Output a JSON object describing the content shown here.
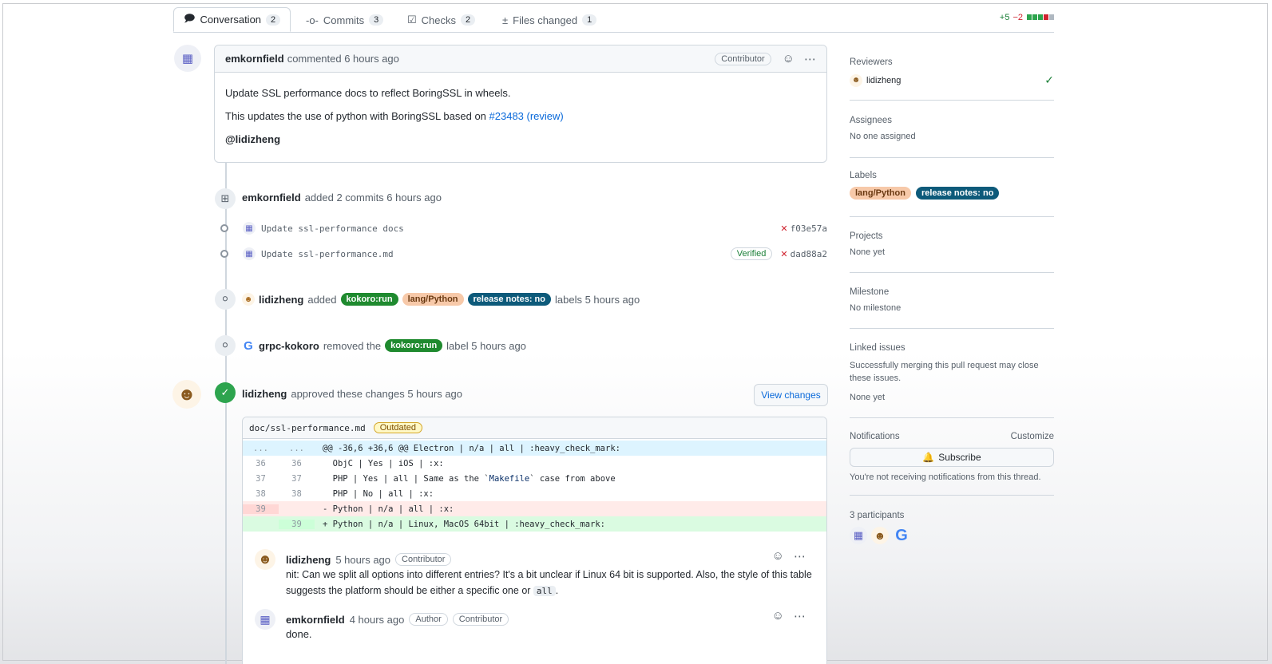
{
  "tabs": {
    "conversation": {
      "label": "Conversation",
      "count": "2"
    },
    "commits": {
      "label": "Commits",
      "count": "3"
    },
    "checks": {
      "label": "Checks",
      "count": "2"
    },
    "files": {
      "label": "Files changed",
      "count": "1"
    }
  },
  "diffstat": {
    "additions": "+5",
    "deletions": "−2"
  },
  "comment": {
    "author": "emkornfield",
    "action": "commented 6 hours ago",
    "badge": "Contributor",
    "line1": "Update SSL performance docs to reflect BoringSSL in wheels.",
    "line2_prefix": "This updates the use of python with BoringSSL based on",
    "line2_link": "#23483 (review)",
    "mention": "@lidizheng"
  },
  "commits_event": {
    "author": "emkornfield",
    "text": "added 2 commits 6 hours ago"
  },
  "commits": [
    {
      "message": "Update ssl-performance docs",
      "sha": "f03e57a",
      "verified": ""
    },
    {
      "message": "Update ssl-performance.md",
      "sha": "dad88a2",
      "verified": "Verified"
    }
  ],
  "labels_event": {
    "author": "lidizheng",
    "verb": "added",
    "suffix": "labels 5 hours ago"
  },
  "label_names": {
    "kokoro": "kokoro:run",
    "python": "lang/Python",
    "release": "release notes: no"
  },
  "removed_event": {
    "author": "grpc-kokoro",
    "verb": "removed the",
    "suffix": "label 5 hours ago"
  },
  "review_event": {
    "author": "lidizheng",
    "text": "approved these changes 5 hours ago",
    "button": "View changes"
  },
  "diff": {
    "file": "doc/ssl-performance.md",
    "outdated": "Outdated",
    "hunk_left": "...",
    "hunk_right": "...",
    "hunk": "@@ -36,6 +36,6 @@ Electron | n/a | all | :heavy_check_mark:",
    "lines": [
      {
        "old": "36",
        "new": "36",
        "text": "  ObjC | Yes | iOS | :x:"
      },
      {
        "old": "37",
        "new": "37",
        "text_a": "  PHP | Yes | all | Same as the `",
        "text_b": "Makefile",
        "text_c": "` case from above"
      },
      {
        "old": "38",
        "new": "38",
        "text": "  PHP | No | all | :x:"
      },
      {
        "old": "39",
        "new": "",
        "text": "- Python | n/a | all | :x:"
      },
      {
        "old": "",
        "new": "39",
        "text": "+ Python | n/a | Linux, MacOS 64bit | :heavy_check_mark:"
      }
    ]
  },
  "review_comments": [
    {
      "author": "lidizheng",
      "time": "5 hours ago",
      "badges": [
        "Contributor"
      ],
      "body_prefix": "nit: Can we split all options into different entries? It's a bit unclear if Linux 64 bit is supported. Also, the style of this table suggests the platform should be either a specific one or",
      "code": "all",
      "body_suffix": "."
    },
    {
      "author": "emkornfield",
      "time": "4 hours ago",
      "badges": [
        "Author",
        "Contributor"
      ],
      "body": "done."
    }
  ],
  "sidebar": {
    "reviewers": {
      "title": "Reviewers",
      "name": "lidizheng"
    },
    "assignees": {
      "title": "Assignees",
      "value": "No one assigned"
    },
    "labels": {
      "title": "Labels"
    },
    "projects": {
      "title": "Projects",
      "value": "None yet"
    },
    "milestone": {
      "title": "Milestone",
      "value": "No milestone"
    },
    "linked": {
      "title": "Linked issues",
      "description": "Successfully merging this pull request may close these issues.",
      "value": "None yet"
    },
    "notifications": {
      "title": "Notifications",
      "customize": "Customize",
      "button": "Subscribe",
      "note": "You're not receiving notifications from this thread."
    },
    "participants": {
      "title": "3 participants"
    }
  },
  "colors": {
    "accent": "#0969da",
    "success": "#1a7f37",
    "danger": "#cf222e"
  }
}
